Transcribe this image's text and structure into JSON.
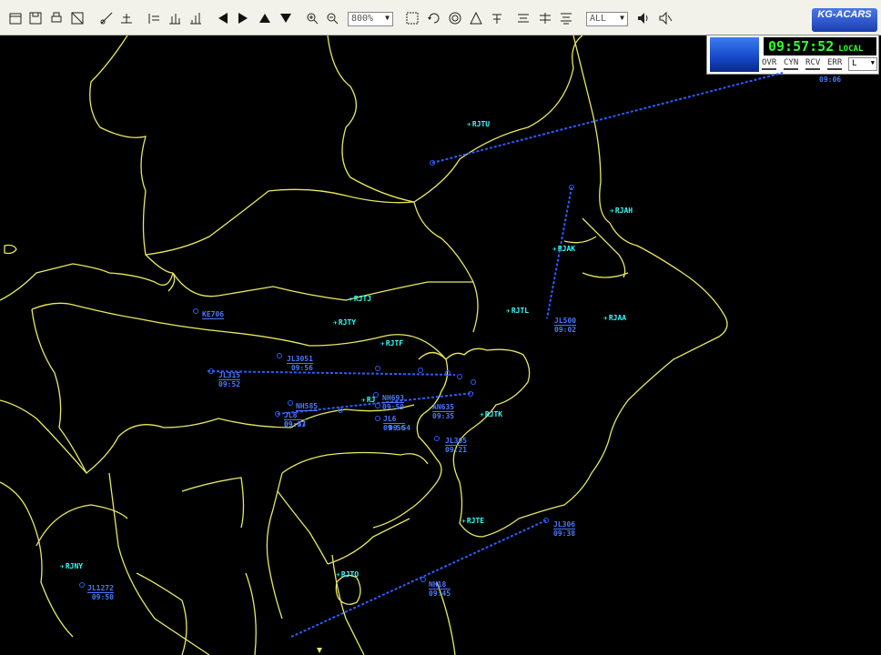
{
  "toolbar": {
    "zoom_select": "800%",
    "filter_select": "ALL",
    "logo_text": "KG-ACARS"
  },
  "clock_panel": {
    "time": "09:57:52",
    "mode": "LOCAL",
    "status_items": [
      "OVR",
      "CYN",
      "RCV",
      "ERR"
    ],
    "status_select": "L"
  },
  "airports": [
    {
      "code": "RJTU"
    },
    {
      "code": "RJAH"
    },
    {
      "code": "RJAK"
    },
    {
      "code": "RJTJ"
    },
    {
      "code": "RJTL"
    },
    {
      "code": "RJAA"
    },
    {
      "code": "RJTY"
    },
    {
      "code": "RJTF"
    },
    {
      "code": "RJTK"
    },
    {
      "code": "RJTE"
    },
    {
      "code": "RJNY"
    },
    {
      "code": "RJTO"
    },
    {
      "code": "RJ"
    }
  ],
  "flights": [
    {
      "id": "KE706",
      "time": ""
    },
    {
      "id": "JL3051",
      "time": "09:56"
    },
    {
      "id": "JL315",
      "time": "09:52"
    },
    {
      "id": "NH693",
      "time": "09:59"
    },
    {
      "id": "NH585",
      "time": ""
    },
    {
      "id": "JL8",
      "time": "09:47"
    },
    {
      "id": "",
      "time": "09:53"
    },
    {
      "id": "JL6",
      "time": "09:56"
    },
    {
      "id": "",
      "time": "09:54"
    },
    {
      "id": "AN635",
      "time": "09:35"
    },
    {
      "id": "JL305",
      "time": "09:21"
    },
    {
      "id": "JL500",
      "time": "09:02"
    },
    {
      "id": "JL306",
      "time": "09:38"
    },
    {
      "id": "NH18",
      "time": "09:45"
    },
    {
      "id": "JL1272",
      "time": "09:50"
    },
    {
      "id": "",
      "time": "09:06"
    }
  ],
  "colors": {
    "background": "#000000",
    "coastline": "#e8e860",
    "track": "#2b5cff",
    "airport": "#33ffff",
    "clock": "#2fff2f"
  }
}
